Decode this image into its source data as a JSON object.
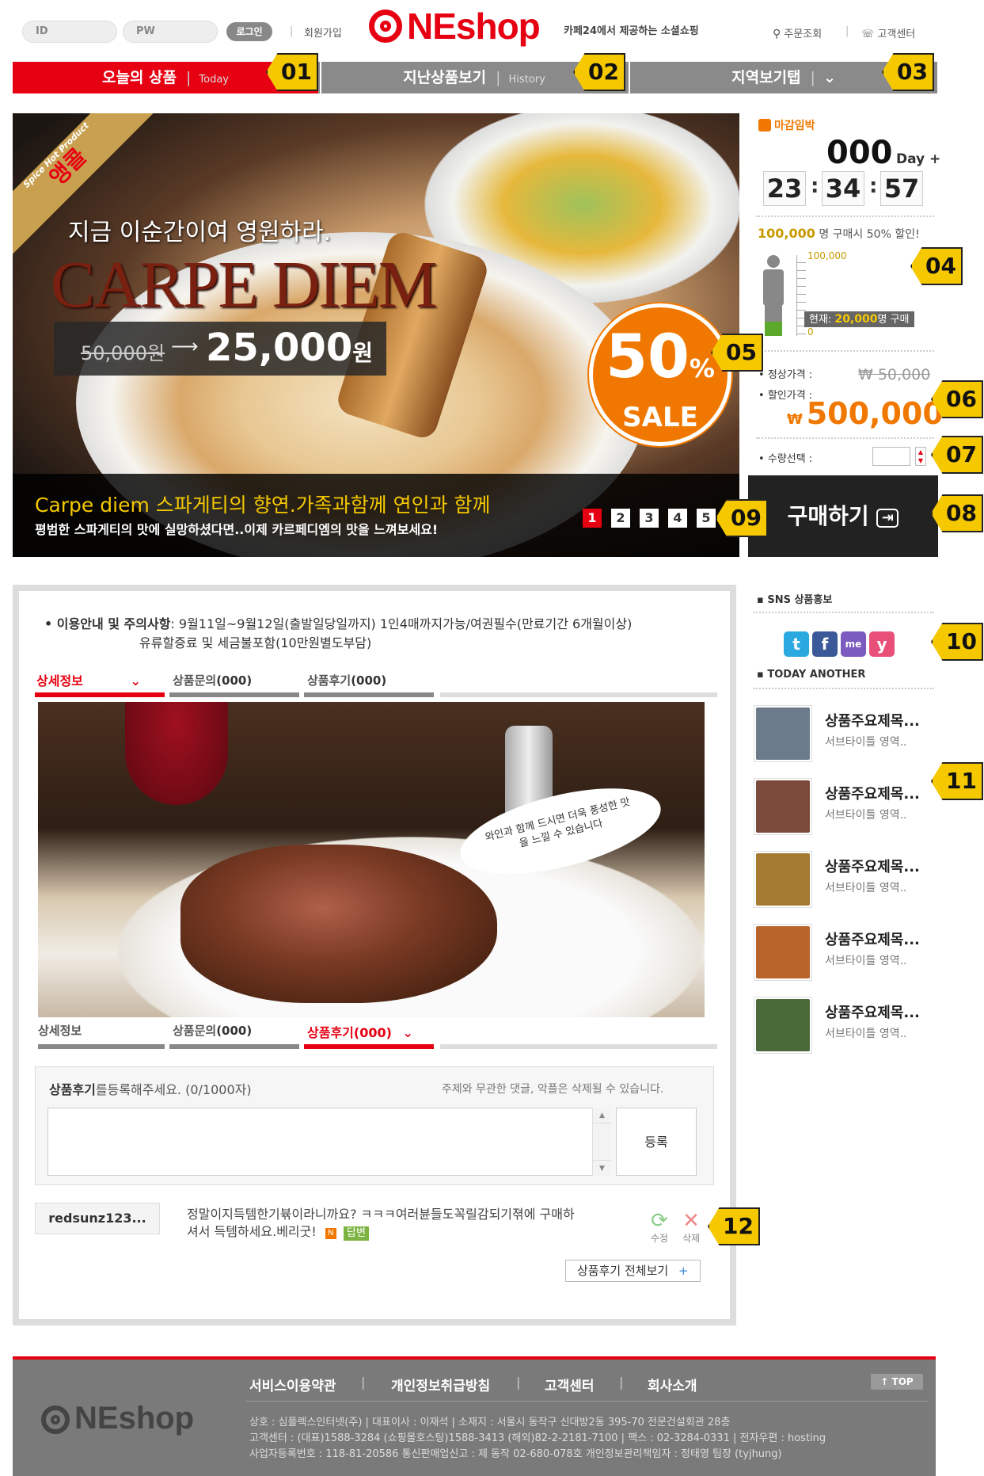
{
  "header": {
    "id_placeholder": "ID",
    "pw_placeholder": "PW",
    "login_label": "로그인",
    "join_label": "회원가입",
    "logo_text": "NEshop",
    "tagline": "카페24에서 제공하는 소셜쇼핑",
    "order_lookup": "주문조회",
    "customer_center": "고객센터"
  },
  "nav": [
    {
      "label": "오늘의 상품",
      "sub": "Today"
    },
    {
      "label": "지난상품보기",
      "sub": "History"
    },
    {
      "label": "지역보기탭"
    }
  ],
  "callouts": [
    "01",
    "02",
    "03",
    "04",
    "05",
    "06",
    "07",
    "08",
    "09",
    "10",
    "11",
    "12"
  ],
  "hero": {
    "badge_en": "Spice Hot Product",
    "badge_ko": "앵콜",
    "headline": "지금 이순간이여 영원하라.",
    "title": "CARPE DIEM",
    "old_price": "50,000원",
    "new_price": "25,000",
    "new_price_unit": "원",
    "sale_pct": "50",
    "sale_pct_sign": "%",
    "sale_word": "SALE",
    "caption_title": "Carpe diem 스파게티의 향연.가족과함께 연인과 함께",
    "caption_sub": "평범한 스파게티의 맛에 실망하셨다면..이제 카르페디엠의 맛을 느껴보세요!",
    "slides": [
      "1",
      "2",
      "3",
      "4",
      "5"
    ],
    "active_slide": 1
  },
  "deal": {
    "deadline_label": "마감임박",
    "days": "000",
    "days_suffix": "Day +",
    "hours": "23",
    "minutes": "34",
    "seconds": "57",
    "target_count": "100,000",
    "target_text": "명 구매시 50% 할인!",
    "gauge_max": "100,000",
    "gauge_min": "0",
    "current_label": "현재:",
    "current_count": "20,000",
    "current_suffix": "명 구매",
    "progress_fraction": 0.2,
    "regular_label": "정상가격 :",
    "regular_price": "₩ 50,000",
    "sale_label": "할인가격 :",
    "sale_currency": "₩",
    "sale_price": "500,000",
    "qty_label": "수량선택 :",
    "buy_label": "구매하기"
  },
  "info": {
    "label": "이용안내 및 주의사항",
    "line1": ": 9월11일~9월12일(출발일당일까지) 1인4매까지가능/여권필수(만료기간 6개월이상)",
    "line2": "유류할증료 및 세금불포함(10만원별도부담)"
  },
  "tabs_top": [
    {
      "label": "상세정보"
    },
    {
      "label": "상품문의",
      "count": "(000)"
    },
    {
      "label": "상품후기",
      "count": "(000)"
    }
  ],
  "steak_bubble": "와인과 함께 드시면 더욱 풍성한 맛을 느낄 수 있습니다",
  "tabs_bottom": [
    {
      "label": "상세정보"
    },
    {
      "label": "상품문의",
      "count": "(000)"
    },
    {
      "label": "상품후기",
      "count": "(000)"
    }
  ],
  "review": {
    "prompt_bold": "상품후기",
    "prompt_rest": "를등록해주세요. (0/1000자)",
    "notice": "주제와 무관한 댓글, 악플은 삭제될 수 있습니다.",
    "submit": "등록",
    "author": "redsunz123...",
    "text1": "정말이지득템한기뷲이라니까요? ㅋㅋㅋ여러뷴들도꼭릴감되기젺에 구매하",
    "text2": "셔서 득템하세요.베리굿!",
    "new_badge": "N",
    "reply_badge": "답변",
    "edit": "수정",
    "delete": "삭제",
    "view_all": "상품후기 전체보기",
    "view_all_plus": "+"
  },
  "side": {
    "sns_title": "SNS 상품홍보",
    "sns_icons": [
      "t",
      "f",
      "me",
      "y"
    ],
    "another_title": "TODAY ANOTHER",
    "items": [
      {
        "title": "상품주요제목...",
        "sub": "서브타이틀 영역..",
        "color": "#6b7b8a"
      },
      {
        "title": "상품주요제목...",
        "sub": "서브타이틀 영역..",
        "color": "#7a4a3a"
      },
      {
        "title": "상품주요제목...",
        "sub": "서브타이틀 영역..",
        "color": "#a37a30"
      },
      {
        "title": "상품주요제목...",
        "sub": "서브타이틀 영역..",
        "color": "#b8642a"
      },
      {
        "title": "상품주요제목...",
        "sub": "서브타이틀 영역..",
        "color": "#4a6a3a"
      }
    ]
  },
  "footer": {
    "links": [
      "서비스이용약관",
      "개인정보취급방침",
      "고객센터",
      "회사소개"
    ],
    "top_btn": "↑ TOP",
    "logo_text": "NEshop",
    "line1": "상호 : 심플렉스인터넷(주) | 대표이사 : 이재석 | 소재지 : 서울시 동작구 신대방2동 395-70 전문건설회관 28층",
    "line2": "고객센터 : (대표)1588-3284 (쇼핑몰호스팅)1588-3413 (해외)82-2-2181-7100 | 팩스 : 02-3284-0331 | 전자우편 : hosting",
    "line3": "사업자등록번호 : 118-81-20586 통신판매업신고 : 제 동작 02-680-078호 개인정보관리책임자 : 정태영 팀장 (tyjhung)"
  },
  "colors": {
    "brand_red": "#e60012",
    "nav_gray": "#8a8a8a",
    "callout_yellow": "#f5c800",
    "price_orange": "#f07800"
  }
}
